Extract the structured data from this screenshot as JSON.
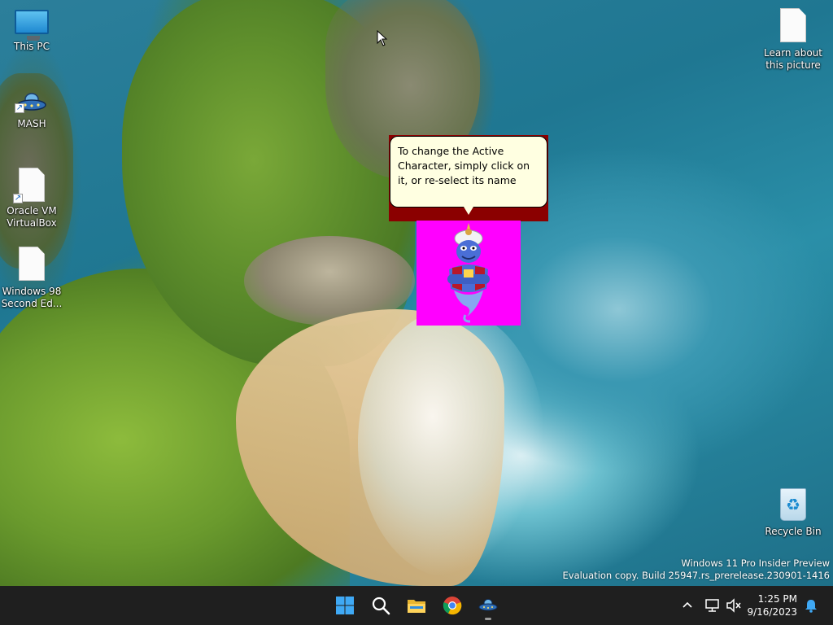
{
  "desktop": {
    "icons": [
      {
        "label": "This PC",
        "icon": "monitor-icon"
      },
      {
        "label": "MASH",
        "icon": "ufo-icon"
      },
      {
        "label": "Oracle VM VirtualBox",
        "icon": "document-icon"
      },
      {
        "label": "Windows 98 Second Ed...",
        "icon": "document-icon"
      },
      {
        "label": "Learn about this picture",
        "icon": "document-icon"
      },
      {
        "label": "Recycle Bin",
        "icon": "recycle-bin-icon"
      }
    ]
  },
  "agent": {
    "balloon_text": "To change the Active Character, simply click on it, or re-select its name",
    "character": "genie-icon",
    "background_color": "#ff00ff"
  },
  "watermark": {
    "line1": "Windows 11 Pro Insider Preview",
    "line2": "Evaluation copy. Build 25947.rs_prerelease.230901-1416"
  },
  "taskbar": {
    "apps": [
      {
        "name": "start-icon"
      },
      {
        "name": "search-icon"
      },
      {
        "name": "file-explorer-icon"
      },
      {
        "name": "chrome-icon"
      },
      {
        "name": "mash-taskbar-icon",
        "running": true
      }
    ],
    "tray": {
      "chevron": "chevron-up-icon",
      "network": "network-icon",
      "volume": "volume-muted-icon",
      "time": "1:25 PM",
      "date": "9/16/2023",
      "notification": "bell-icon"
    }
  },
  "colors": {
    "taskbar_bg": "#1f1f1f",
    "balloon_bg": "#ffffe1",
    "balloon_frame": "#8b0000"
  }
}
